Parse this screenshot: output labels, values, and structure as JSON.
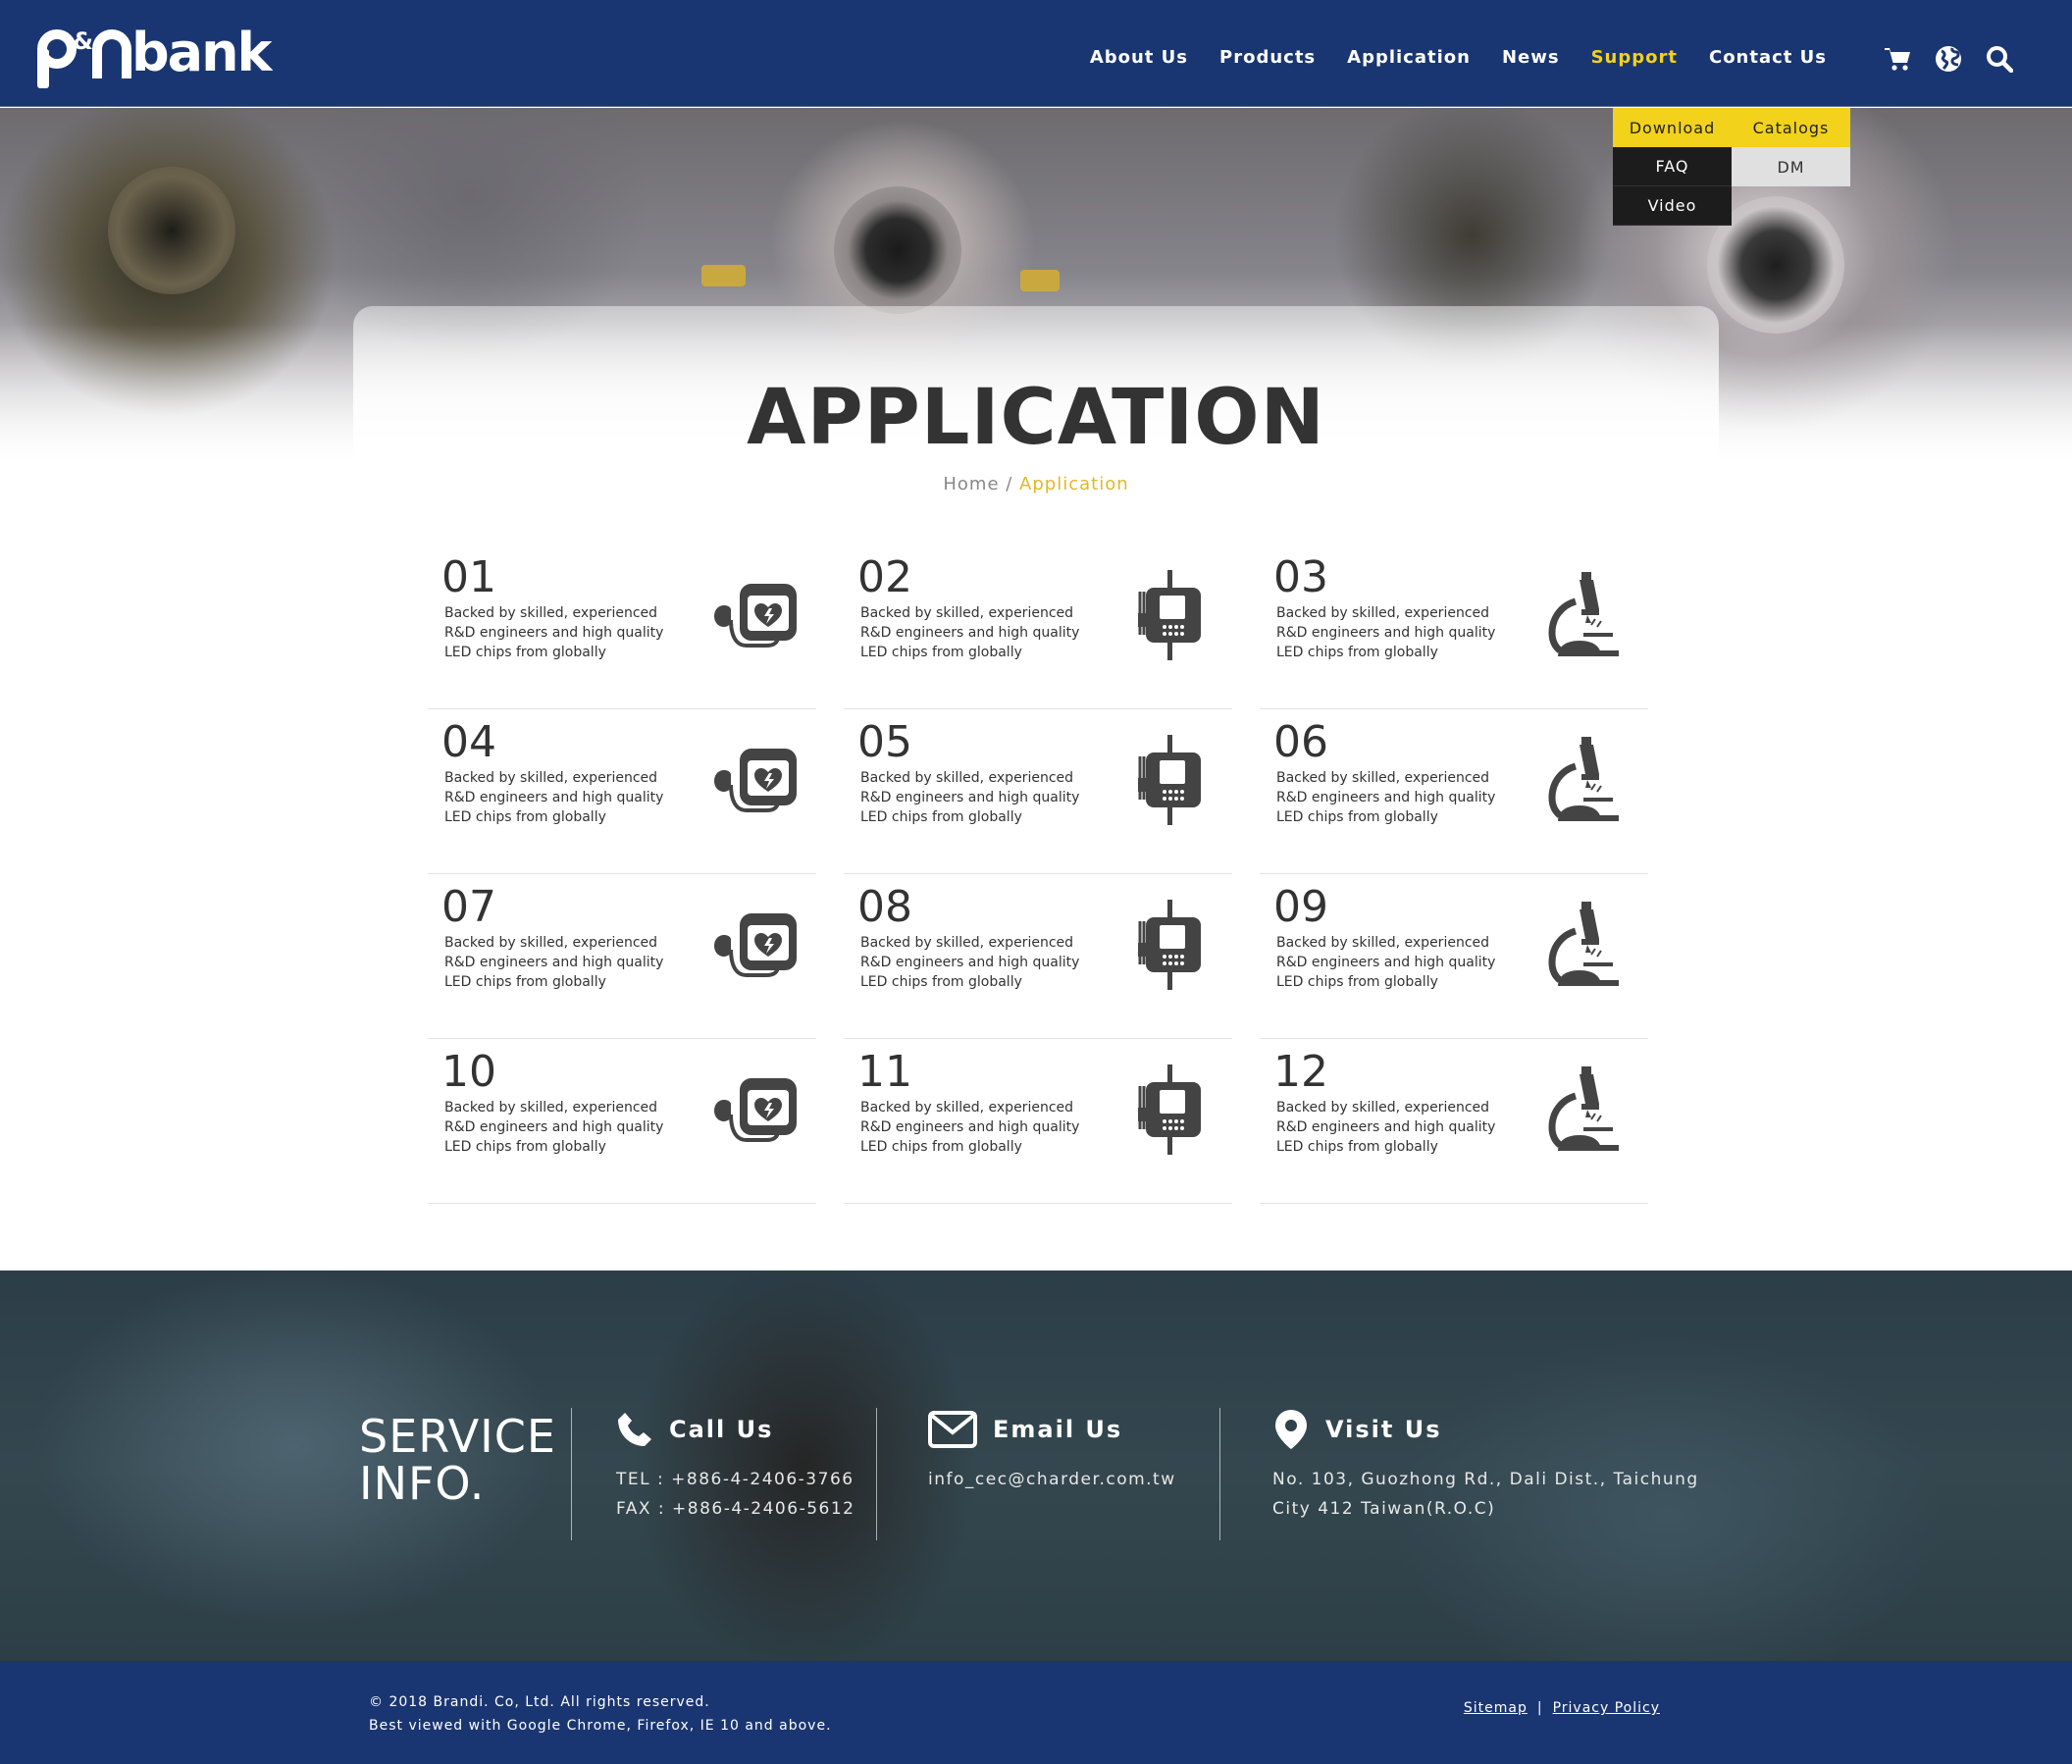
{
  "brand": {
    "logo_text": "p&nbank"
  },
  "nav": [
    {
      "label": "About Us",
      "active": false
    },
    {
      "label": "Products",
      "active": false
    },
    {
      "label": "Application",
      "active": false
    },
    {
      "label": "News",
      "active": false
    },
    {
      "label": "Support",
      "active": true
    },
    {
      "label": "Contact Us",
      "active": false
    }
  ],
  "header_icons": [
    "cart-icon",
    "globe-icon",
    "search-icon"
  ],
  "support_menu": {
    "download": "Download",
    "catalogs": "Catalogs",
    "faq": "FAQ",
    "dm": "DM",
    "video": "Video"
  },
  "page": {
    "title": "APPLICATION",
    "breadcrumb_home": "Home",
    "breadcrumb_sep": " / ",
    "breadcrumb_current": "Application"
  },
  "applications": [
    {
      "num": "01",
      "text": "Backed by skilled, experienced R&D engineers and high quality LED chips from globally",
      "icon": "defibrillator-icon"
    },
    {
      "num": "02",
      "text": "Backed by skilled, experienced R&D engineers and high quality LED chips from globally",
      "icon": "infusion-pump-icon"
    },
    {
      "num": "03",
      "text": "Backed by skilled, experienced R&D engineers and high quality LED chips from globally",
      "icon": "microscope-icon"
    },
    {
      "num": "04",
      "text": "Backed by skilled, experienced R&D engineers and high quality LED chips from globally",
      "icon": "defibrillator-icon"
    },
    {
      "num": "05",
      "text": "Backed by skilled, experienced R&D engineers and high quality LED chips from globally",
      "icon": "infusion-pump-icon"
    },
    {
      "num": "06",
      "text": "Backed by skilled, experienced R&D engineers and high quality LED chips from globally",
      "icon": "microscope-icon"
    },
    {
      "num": "07",
      "text": "Backed by skilled, experienced R&D engineers and high quality LED chips from globally",
      "icon": "defibrillator-icon"
    },
    {
      "num": "08",
      "text": "Backed by skilled, experienced R&D engineers and high quality LED chips from globally",
      "icon": "infusion-pump-icon"
    },
    {
      "num": "09",
      "text": "Backed by skilled, experienced R&D engineers and high quality LED chips from globally",
      "icon": "microscope-icon"
    },
    {
      "num": "10",
      "text": "Backed by skilled, experienced R&D engineers and high quality LED chips from globally",
      "icon": "defibrillator-icon"
    },
    {
      "num": "11",
      "text": "Backed by skilled, experienced R&D engineers and high quality LED chips from globally",
      "icon": "infusion-pump-icon"
    },
    {
      "num": "12",
      "text": "Backed by skilled, experienced R&D engineers and high quality LED chips from globally",
      "icon": "microscope-icon"
    }
  ],
  "service": {
    "title_line1": "SERVICE",
    "title_line2": "INFO.",
    "call": {
      "label": "Call Us",
      "tel": "TEL : +886-4-2406-3766",
      "fax": "FAX : +886-4-2406-5612"
    },
    "email": {
      "label": "Email Us",
      "address": "info_cec@charder.com.tw"
    },
    "visit": {
      "label": "Visit Us",
      "line1": "No. 103, Guozhong Rd., Dali Dist., Taichung",
      "line2": "City 412 Taiwan(R.O.C)"
    }
  },
  "footer": {
    "copyright": "© 2018 Brandi. Co, Ltd. All rights reserved.",
    "browsers": "Best viewed with Google Chrome, Firefox, IE 10 and above.",
    "sitemap": "Sitemap",
    "separator": "|",
    "privacy": "Privacy Policy"
  },
  "colors": {
    "header_bg": "#1a3672",
    "accent": "#f2d21b",
    "text": "#333333"
  }
}
